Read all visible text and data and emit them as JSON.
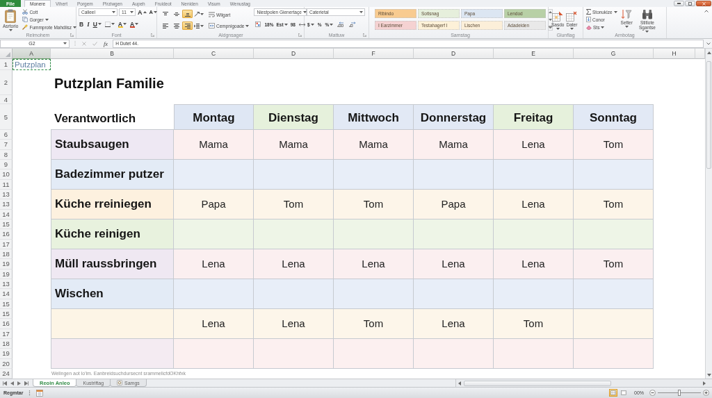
{
  "ribbon_tabs": [
    {
      "label": "File",
      "kind": "file",
      "selected": false
    },
    {
      "label": "Monere",
      "kind": "tab",
      "selected": true
    },
    {
      "label": "Vihert",
      "kind": "tab",
      "selected": false
    },
    {
      "label": "Porgem",
      "kind": "tab",
      "selected": false
    },
    {
      "label": "Pirziwgen",
      "kind": "tab",
      "selected": false
    },
    {
      "label": "Aupeh",
      "kind": "tab",
      "selected": false
    },
    {
      "label": "Fruideot",
      "kind": "tab",
      "selected": false
    },
    {
      "label": "Neniden",
      "kind": "tab",
      "selected": false
    },
    {
      "label": "Visum",
      "kind": "tab",
      "selected": false
    },
    {
      "label": "Wenustag",
      "kind": "tab",
      "selected": false
    }
  ],
  "ribbon": {
    "clipboard": {
      "label": "Relmohem",
      "paste": "Asrtorio",
      "actions": [
        {
          "kind": "cut",
          "label": "Cott",
          "menu": false
        },
        {
          "kind": "copy",
          "label": "Gorger",
          "menu": true
        },
        {
          "kind": "painter",
          "label": "Fummprote Mahdiisz",
          "menu": true
        }
      ]
    },
    "font": {
      "label": "Font",
      "name": "Calleel",
      "size": "11",
      "size_buttons": [
        {
          "kind": "grow",
          "text": "A"
        },
        {
          "kind": "shrink",
          "text": "A"
        }
      ],
      "format_buttons": [
        {
          "kind": "bold",
          "text": "B",
          "menu": false
        },
        {
          "kind": "italic",
          "text": "I",
          "menu": false
        },
        {
          "kind": "underline",
          "text": "U",
          "menu": true
        },
        {
          "kind": "border",
          "menu": true
        },
        {
          "kind": "highlight",
          "text": "A",
          "color": "#f2c12e",
          "menu": true
        },
        {
          "kind": "font-color",
          "text": "A",
          "color": "#d4452b",
          "menu": true
        }
      ]
    },
    "alignment": {
      "label": "Aldgnsager",
      "buttons": [
        {
          "kind": "top",
          "selected": false
        },
        {
          "kind": "middle",
          "selected": false
        },
        {
          "kind": "bottom",
          "selected": true
        },
        {
          "kind": "orientation",
          "selected": false
        },
        {
          "kind": "left",
          "selected": false
        },
        {
          "kind": "center",
          "selected": false
        },
        {
          "kind": "right",
          "selected": true
        },
        {
          "kind": "indent",
          "selected": false
        }
      ],
      "wrap": "Wilgart",
      "merge": "Cempnigoade",
      "format_box": "Niestpolen Gienertaçe",
      "format_tools": [
        {
          "kind": "table"
        },
        {
          "kind": "text",
          "text": "18%",
          "menu": false
        },
        {
          "kind": "text",
          "text": "Est",
          "menu": true
        },
        {
          "kind": "text",
          "text": "98",
          "menu": false
        },
        {
          "kind": "arrows"
        }
      ]
    },
    "number": {
      "label": "Mattuw",
      "format": "Caterietal",
      "buttons": [
        {
          "kind": "text",
          "text": "$",
          "menu": true
        },
        {
          "kind": "text",
          "text": "%",
          "menu": false
        },
        {
          "kind": "text",
          "text": "%",
          "menu": true
        },
        {
          "kind": "decimals-more"
        },
        {
          "kind": "decimals-less"
        }
      ]
    },
    "styles": {
      "label": "Samstag",
      "cells": [
        {
          "label": "Rlbindo",
          "color": "#f8cb90"
        },
        {
          "label": "Sotlsnag",
          "color": "#e6efdc"
        },
        {
          "label": "Papa",
          "color": "#dce6f2"
        },
        {
          "label": "Lendod",
          "color": "#b8d0a6"
        },
        {
          "label": "I Earzimmer",
          "color": "#f5d2d2"
        },
        {
          "label": "Testahagerf I",
          "color": "#fdf1d8"
        },
        {
          "label": "Lischen",
          "color": "#fcefd9"
        },
        {
          "label": "Adadeiden",
          "color": "#e9e9e9"
        }
      ]
    },
    "cells": {
      "label": "Glunflag",
      "buttons": [
        {
          "kind": "insert",
          "label": "Sasdo",
          "menu": true
        },
        {
          "kind": "delete",
          "label": "Dater",
          "menu": true
        }
      ]
    },
    "editing": {
      "label": "Arnbotag",
      "small": [
        {
          "kind": "sum",
          "label": "Stonukize",
          "menu": true
        },
        {
          "kind": "fill",
          "label": "Conor",
          "menu": false
        },
        {
          "kind": "clear",
          "label": "Sts",
          "menu": true
        }
      ],
      "large": [
        {
          "kind": "sort",
          "label": "Setter",
          "menu": true
        },
        {
          "kind": "find",
          "label": "Stitlote Sgantse",
          "menu": true
        }
      ]
    }
  },
  "formula_bar": {
    "name_box": "G2",
    "function_label": "fx",
    "formula": "H Dutet 44."
  },
  "sheet": {
    "columns": [
      {
        "label": "A",
        "selected": true
      },
      {
        "label": "B",
        "selected": false
      },
      {
        "label": "C",
        "selected": false
      },
      {
        "label": "D",
        "selected": false
      },
      {
        "label": "F",
        "selected": false
      },
      {
        "label": "D",
        "selected": false
      },
      {
        "label": "E",
        "selected": false
      },
      {
        "label": "G",
        "selected": false
      },
      {
        "label": "H",
        "selected": false
      }
    ],
    "rows": [
      "1",
      "2",
      "4",
      "5",
      "6",
      "7",
      "8",
      "9",
      "10",
      "11",
      "13",
      "13",
      "14",
      "15",
      "16",
      "17",
      "18",
      "19",
      "19",
      "13",
      "14",
      "15",
      "15",
      "16",
      "17",
      "18",
      "19",
      "20",
      "24"
    ],
    "title_cell": {
      "text": "Putzplan",
      "selected": true
    },
    "heading": "Putzplan Familie",
    "table": {
      "corner": "Verantwortlich",
      "days": [
        {
          "label": "Montag",
          "color": "#dfe7f4"
        },
        {
          "label": "Dienstag",
          "color": "#e6f1dc"
        },
        {
          "label": "Mittwoch",
          "color": "#e2e9f5"
        },
        {
          "label": "Donnerstag",
          "color": "#e2e9f5"
        },
        {
          "label": "Freitag",
          "color": "#e6f1dc"
        },
        {
          "label": "Sonntag",
          "color": "#e2e9f5"
        }
      ],
      "tasks": [
        {
          "name": {
            "text": "Staubsaugen",
            "color": "#eee8f3"
          },
          "color": "#fcefef",
          "cells": [
            "Mama",
            "Mama",
            "Mama",
            "Mama",
            "Lena",
            "Tom"
          ]
        },
        {
          "name": {
            "text": "Badezimmer putzer",
            "color": "#e3ebf6"
          },
          "color": "#e8eef8"
        },
        {
          "name": {
            "text": "Küche rreiniegen",
            "color": "#fdf1df"
          },
          "color": "#fdf5e9",
          "cells": [
            "Papa",
            "Tom",
            "Tom",
            "Papa",
            "Lena",
            "Tom"
          ]
        },
        {
          "name": {
            "text": "Küche reinigen",
            "color": "#e8f2de"
          },
          "color": "#eef5e7"
        },
        {
          "name": {
            "text": "Müll raussbringen",
            "color": "#efe8f2"
          },
          "color": "#fbeff0",
          "cells": [
            "Lena",
            "Lena",
            "Lena",
            "Lena",
            "Lena",
            "Tom"
          ]
        },
        {
          "name": {
            "text": "Wischen",
            "color": "#e3ebf6"
          },
          "color": "#e8eef8"
        },
        {
          "name": {
            "color": "#fdf5e6"
          },
          "color": "#fdf6ea",
          "cells": [
            "Lena",
            "Lena",
            "Tom",
            "Lena",
            "Tom",
            null
          ]
        },
        {
          "name": {
            "color": "#f4ebf2"
          },
          "color": "#fcf0f0"
        }
      ]
    },
    "footnote": "Welingen aot lo'im. Eanbreidsuchdursecnt srammelicfdOKhfxk"
  },
  "sheet_tabs": [
    {
      "label": "Reoin Anleo",
      "kind": "plain",
      "selected": true
    },
    {
      "label": "Kustriftag",
      "kind": "plain",
      "selected": false
    },
    {
      "label": "Samgs",
      "kind": "icon",
      "selected": false
    }
  ],
  "status_bar": {
    "mode": "Regmtar",
    "views": [
      {
        "kind": "normal",
        "selected": true
      },
      {
        "kind": "page-layout",
        "selected": false
      }
    ],
    "zoom": "00%",
    "zoom_slider": {
      "level": 0.5
    }
  }
}
